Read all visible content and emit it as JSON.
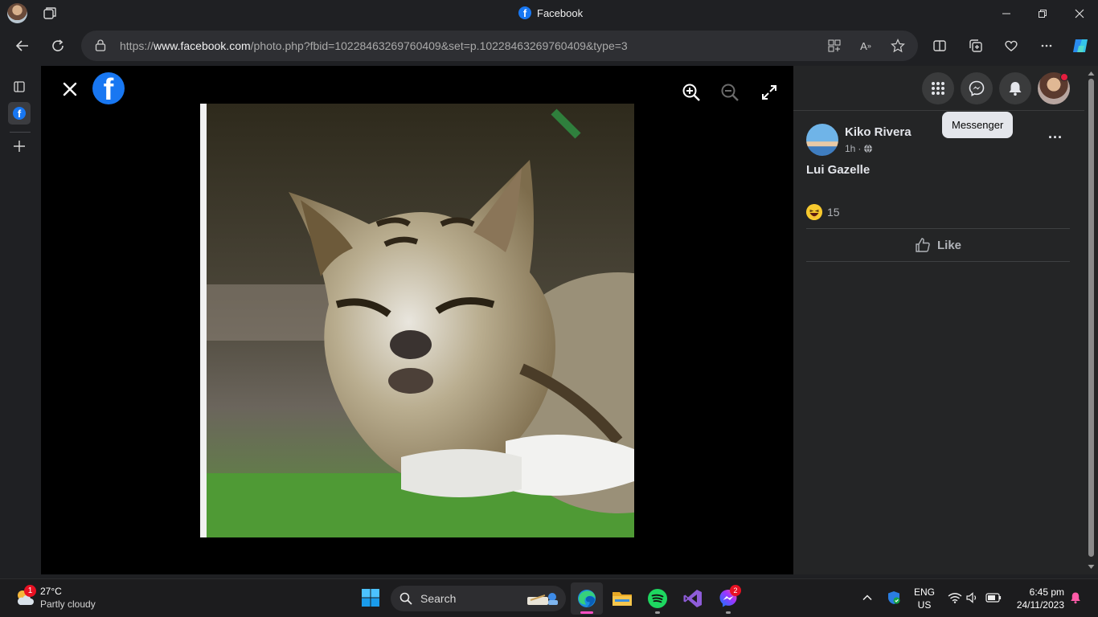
{
  "browser": {
    "tab_title": "Facebook",
    "url_prefix": "https://",
    "url_domain": "www.facebook.com",
    "url_path": "/photo.php?fbid=10228463269760409&set=p.10228463269760409&type=3"
  },
  "viewer": {
    "photo_alt": "Photo of a squinting tabby cat"
  },
  "header": {
    "tooltip": "Messenger"
  },
  "post": {
    "author": "Kiko Rivera",
    "time": "1h",
    "separator": "·",
    "caption": "Lui Gazelle",
    "reaction_count": "15",
    "like_label": "Like",
    "more_label": "···"
  },
  "taskbar": {
    "weather_badge": "1",
    "temperature": "27°C",
    "weather": "Partly cloudy",
    "search_label": "Search",
    "messenger_badge": "2",
    "lang_top": "ENG",
    "lang_bottom": "US",
    "time": "6:45 pm",
    "date": "24/11/2023"
  },
  "colors": {
    "facebook_blue": "#1877f2",
    "panel_bg": "#242526",
    "notification_red": "#e41e3f"
  }
}
